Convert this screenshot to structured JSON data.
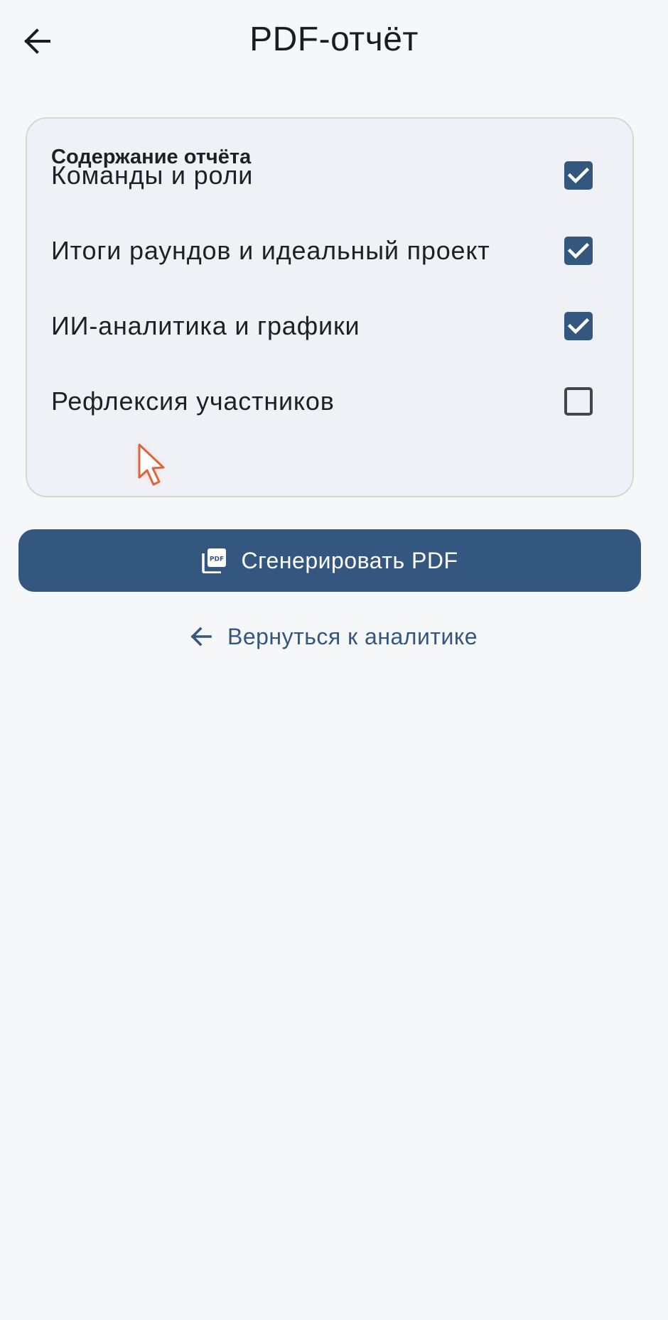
{
  "header": {
    "title": "PDF-отчёт",
    "back_icon": "arrow-left-icon"
  },
  "card": {
    "title": "Содержание отчёта",
    "options": [
      {
        "label": "Команды и роли",
        "checked": true
      },
      {
        "label": "Итоги раундов и идеальный проект",
        "checked": true
      },
      {
        "label": "ИИ-аналитика и графики",
        "checked": true
      },
      {
        "label": "Рефлексия участников",
        "checked": false
      }
    ]
  },
  "generate_button": {
    "label": "Сгенерировать PDF",
    "icon": "pdf-icon"
  },
  "back_link": {
    "label": "Вернуться к аналитике",
    "icon": "arrow-left-icon"
  },
  "colors": {
    "accent": "#34577f",
    "background": "#f6f7f9",
    "card": "#f0f1f7"
  }
}
